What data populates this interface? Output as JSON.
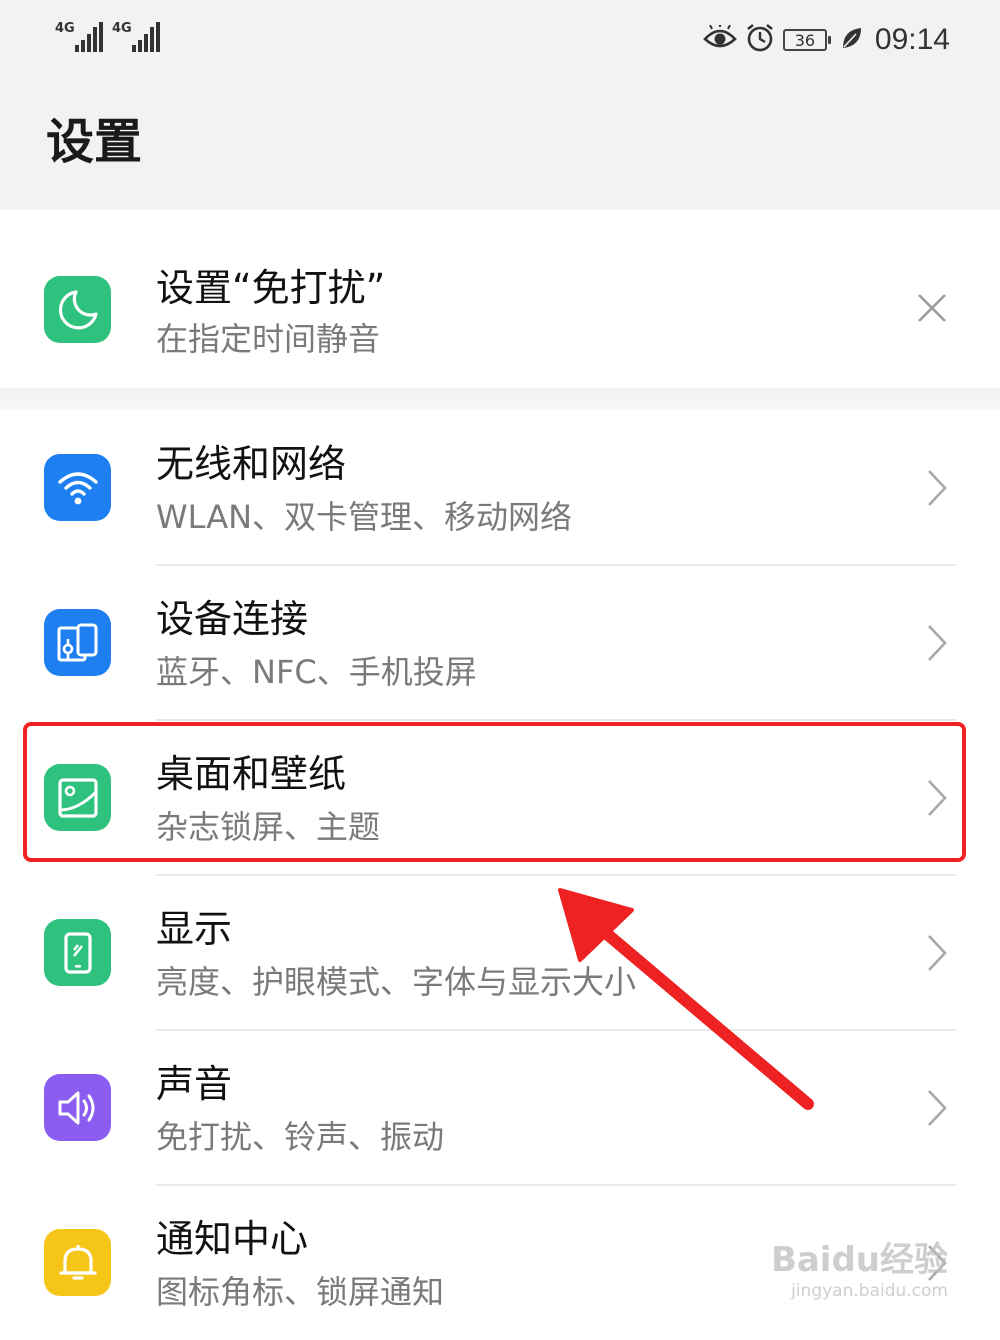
{
  "status_bar": {
    "signal_1": "4G",
    "signal_2": "4G",
    "battery_level": "36",
    "time": "09:14",
    "icons": [
      "eye-comfort-icon",
      "alarm-icon",
      "battery-icon",
      "leaf-icon"
    ]
  },
  "header": {
    "title": "设置"
  },
  "suggestion": {
    "title": "设置“免打扰”",
    "subtitle": "在指定时间静音",
    "icon": "moon-icon",
    "icon_color": "#2ec27e",
    "dismiss_icon": "close-icon"
  },
  "settings": [
    {
      "id": "network",
      "title": "无线和网络",
      "subtitle": "WLAN、双卡管理、移动网络",
      "icon": "wifi-icon",
      "icon_color": "#1e7ff0"
    },
    {
      "id": "device-connect",
      "title": "设备连接",
      "subtitle": "蓝牙、NFC、手机投屏",
      "icon": "device-connect-icon",
      "icon_color": "#1e7ff0"
    },
    {
      "id": "home-wallpaper",
      "title": "桌面和壁纸",
      "subtitle": "杂志锁屏、主题",
      "icon": "wallpaper-icon",
      "icon_color": "#2ec27e",
      "highlighted": true
    },
    {
      "id": "display",
      "title": "显示",
      "subtitle": "亮度、护眼模式、字体与显示大小",
      "icon": "display-icon",
      "icon_color": "#2ec27e"
    },
    {
      "id": "sound",
      "title": "声音",
      "subtitle": "免打扰、铃声、振动",
      "icon": "speaker-icon",
      "icon_color": "#8a5cf0"
    },
    {
      "id": "notifications",
      "title": "通知中心",
      "subtitle": "图标角标、锁屏通知",
      "icon": "bell-icon",
      "icon_color": "#f5c518"
    }
  ],
  "annotation": {
    "highlight_color": "#ee2222",
    "arrow_color": "#ee2222"
  },
  "watermark": {
    "brand": "Baidu经验",
    "url": "jingyan.baidu.com"
  }
}
